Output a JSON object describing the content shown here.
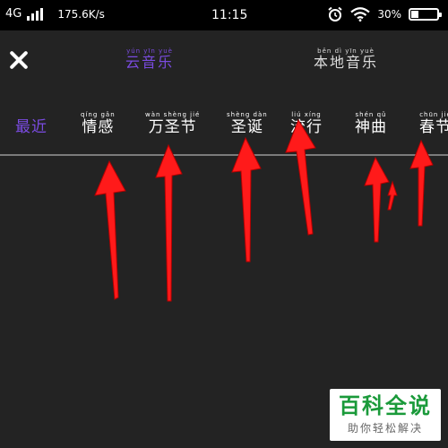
{
  "status_bar": {
    "network_type": "4G",
    "signal_bars": 4,
    "speed": "175.6K/s",
    "time": "11:15",
    "alarm_icon": "alarm-clock-icon",
    "wifi_icon": "wifi-icon",
    "battery_percent": "30%",
    "battery_level": 0.3
  },
  "header": {
    "close_icon": "close-icon",
    "tabs": [
      {
        "pinyin": "yún yīn yuè",
        "label": "云音乐",
        "active": true
      },
      {
        "pinyin": "běn dì yīn yuè",
        "label": "本地音乐",
        "active": false
      }
    ]
  },
  "categories": [
    {
      "pinyin": "",
      "label": "最近",
      "active": true
    },
    {
      "pinyin": "qíng gǎn",
      "label": "情感",
      "active": false
    },
    {
      "pinyin": "wàn shèng jié",
      "label": "万圣节",
      "active": false
    },
    {
      "pinyin": "shèng dàn",
      "label": "圣诞",
      "active": false
    },
    {
      "pinyin": "liú xíng",
      "label": "流行",
      "active": false
    },
    {
      "pinyin": "shén qǔ",
      "label": "神曲",
      "active": false
    },
    {
      "pinyin": "chūn jié",
      "label": "春节",
      "active": false
    }
  ],
  "colors": {
    "accent": "#7a4be0",
    "background": "#232323",
    "arrow": "#ff1a1a",
    "watermark_green": "#1a9a3a"
  },
  "watermark": {
    "title": "百科全说",
    "subtitle": "助你轻松解决"
  }
}
